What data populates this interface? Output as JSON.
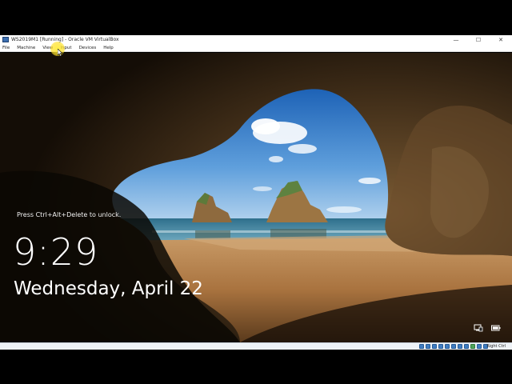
{
  "window": {
    "title": "WS2019M1 [Running] - Oracle VM VirtualBox",
    "controls": {
      "minimize": "—",
      "maximize": "☐",
      "close": "✕"
    }
  },
  "menu": {
    "items": [
      {
        "label": "File"
      },
      {
        "label": "Machine"
      },
      {
        "label": "View"
      },
      {
        "label": "Input"
      },
      {
        "label": "Devices"
      },
      {
        "label": "Help"
      }
    ]
  },
  "lockscreen": {
    "prompt": "Press Ctrl+Alt+Delete to unlock.",
    "time": "9:29",
    "date": "Wednesday, April 22"
  },
  "statusbar": {
    "host_key": "Right Ctrl"
  },
  "icons": {
    "app": "virtualbox-icon",
    "network": "network-icon",
    "battery": "battery-icon",
    "cursor": "mouse-pointer-icon"
  },
  "colors": {
    "sky_top": "#1a5fb4",
    "sky_bottom": "#9cc6e8",
    "sea": "#3e7f9a",
    "sand": "#b88554",
    "cave": "#1b130b",
    "highlight": "#ffe83c"
  }
}
